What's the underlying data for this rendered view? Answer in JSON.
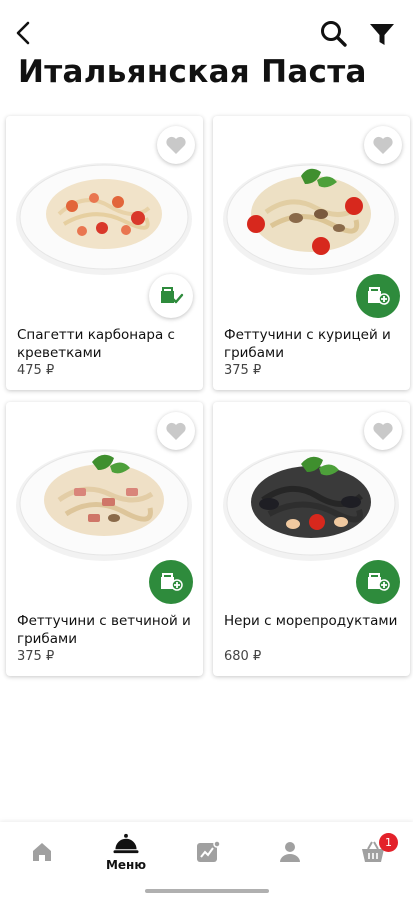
{
  "page": {
    "title": "Итальянская Паста"
  },
  "colors": {
    "accent": "#2e8b3c",
    "badge": "#e3212a"
  },
  "products": [
    {
      "name": "Спагетти карбонара с креветками",
      "price": "475 ₽",
      "in_cart": true
    },
    {
      "name": "Феттучини с курицей и грибами",
      "price": "375 ₽",
      "in_cart": false
    },
    {
      "name": "Феттучини с ветчиной и грибами",
      "price": "375 ₽",
      "in_cart": false
    },
    {
      "name": "Нери с морепродуктами",
      "price": "680 ₽",
      "in_cart": false
    }
  ],
  "bottom_nav": {
    "items": [
      {
        "icon": "home-icon",
        "label": ""
      },
      {
        "icon": "cloche-icon",
        "label": "Меню",
        "active": true
      },
      {
        "icon": "chart-icon",
        "label": ""
      },
      {
        "icon": "user-icon",
        "label": ""
      },
      {
        "icon": "basket-icon",
        "label": ""
      }
    ],
    "cart_count": "1"
  }
}
